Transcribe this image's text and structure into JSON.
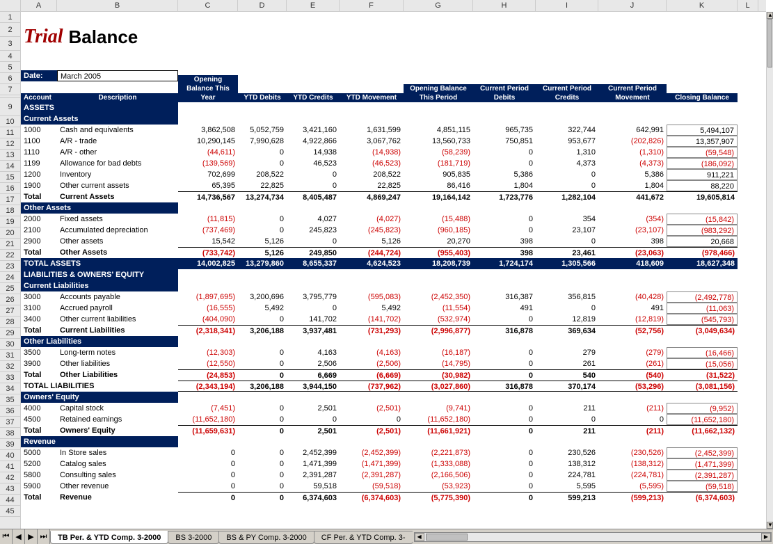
{
  "title": {
    "trial": "Trial",
    "balance": "Balance"
  },
  "date_label": "Date:",
  "date_value": "March 2005",
  "columns": {
    "letters": [
      "A",
      "B",
      "C",
      "D",
      "E",
      "F",
      "G",
      "H",
      "I",
      "J",
      "K",
      "L"
    ],
    "widths": [
      52,
      174,
      86,
      70,
      76,
      92,
      100,
      90,
      90,
      98,
      102,
      30
    ]
  },
  "header": {
    "account": "Account",
    "description": "Description",
    "c": "Opening Balance This Year",
    "d": "YTD Debits",
    "e": "YTD Credits",
    "f": "YTD Movement",
    "g": "Opening Balance This Period",
    "h": "Current Period Debits",
    "i": "Current Period Credits",
    "j": "Current Period Movement",
    "k": "Closing Balance"
  },
  "row_nums": [
    1,
    2,
    3,
    4,
    5,
    6,
    7,
    8,
    9,
    10,
    11,
    12,
    13,
    14,
    15,
    16,
    17,
    18,
    19,
    20,
    21,
    22,
    23,
    24,
    25,
    26,
    27,
    28,
    29,
    30,
    31,
    32,
    33,
    34,
    35,
    36,
    37,
    38,
    39,
    40,
    41,
    42,
    43,
    44,
    45
  ],
  "sections": {
    "assets": "ASSETS",
    "current_assets": "Current Assets",
    "other_assets": "Other Assets",
    "total_assets": "TOTAL ASSETS",
    "liab_eq": "LIABILITIES & OWNERS' EQUITY",
    "current_liab": "Current Liabilities",
    "other_liab": "Other Liabilities",
    "total_liab": "TOTAL LIABILITIES",
    "owners_eq": "Owners' Equity",
    "revenue": "Revenue"
  },
  "rows": [
    {
      "a": "1000",
      "b": "Cash and equivalents",
      "c": "3,862,508",
      "d": "5,052,759",
      "e": "3,421,160",
      "f": "1,631,599",
      "g": "4,851,115",
      "h": "965,735",
      "i": "322,744",
      "j": "642,991",
      "k": "5,494,107"
    },
    {
      "a": "1100",
      "b": "A/R - trade",
      "c": "10,290,145",
      "d": "7,990,628",
      "e": "4,922,866",
      "f": "3,067,762",
      "g": "13,560,733",
      "h": "750,851",
      "i": "953,677",
      "j": "(202,826)",
      "jn": 1,
      "k": "13,357,907"
    },
    {
      "a": "1110",
      "b": "A/R - other",
      "c": "(44,611)",
      "cn": 1,
      "d": "0",
      "e": "14,938",
      "f": "(14,938)",
      "fn": 1,
      "g": "(58,239)",
      "gn": 1,
      "h": "0",
      "i": "1,310",
      "j": "(1,310)",
      "jn": 1,
      "k": "(59,548)",
      "kn": 1
    },
    {
      "a": "1199",
      "b": "Allowance for bad debts",
      "c": "(139,569)",
      "cn": 1,
      "d": "0",
      "e": "46,523",
      "f": "(46,523)",
      "fn": 1,
      "g": "(181,719)",
      "gn": 1,
      "h": "0",
      "i": "4,373",
      "j": "(4,373)",
      "jn": 1,
      "k": "(186,092)",
      "kn": 1
    },
    {
      "a": "1200",
      "b": "Inventory",
      "c": "702,699",
      "d": "208,522",
      "e": "0",
      "f": "208,522",
      "g": "905,835",
      "h": "5,386",
      "i": "0",
      "j": "5,386",
      "k": "911,221"
    },
    {
      "a": "1900",
      "b": "Other current assets",
      "c": "65,395",
      "d": "22,825",
      "e": "0",
      "f": "22,825",
      "g": "86,416",
      "h": "1,804",
      "i": "0",
      "j": "1,804",
      "k": "88,220"
    },
    {
      "a": "Total",
      "b": "Current Assets",
      "c": "14,736,567",
      "d": "13,274,734",
      "e": "8,405,487",
      "f": "4,869,247",
      "g": "19,164,142",
      "h": "1,723,776",
      "i": "1,282,104",
      "j": "441,672",
      "k": "19,605,814",
      "bold": 1,
      "btop": 1
    },
    {
      "sect": "other_assets"
    },
    {
      "a": "2000",
      "b": "Fixed assets",
      "c": "(11,815)",
      "cn": 1,
      "d": "0",
      "e": "4,027",
      "f": "(4,027)",
      "fn": 1,
      "g": "(15,488)",
      "gn": 1,
      "h": "0",
      "i": "354",
      "j": "(354)",
      "jn": 1,
      "k": "(15,842)",
      "kn": 1
    },
    {
      "a": "2100",
      "b": "Accumulated depreciation",
      "c": "(737,469)",
      "cn": 1,
      "d": "0",
      "e": "245,823",
      "f": "(245,823)",
      "fn": 1,
      "g": "(960,185)",
      "gn": 1,
      "h": "0",
      "i": "23,107",
      "j": "(23,107)",
      "jn": 1,
      "k": "(983,292)",
      "kn": 1
    },
    {
      "a": "2900",
      "b": "Other assets",
      "c": "15,542",
      "d": "5,126",
      "e": "0",
      "f": "5,126",
      "g": "20,270",
      "h": "398",
      "i": "0",
      "j": "398",
      "k": "20,668"
    },
    {
      "a": "Total",
      "b": "Other Assets",
      "c": "(733,742)",
      "cn": 1,
      "d": "5,126",
      "e": "249,850",
      "f": "(244,724)",
      "fn": 1,
      "g": "(955,403)",
      "gn": 1,
      "h": "398",
      "i": "23,461",
      "j": "(23,063)",
      "jn": 1,
      "k": "(978,466)",
      "kn": 1,
      "bold": 1,
      "btop": 1
    },
    {
      "total": 1,
      "a": "TOTAL ASSETS",
      "b": "",
      "c": "14,002,825",
      "d": "13,279,860",
      "e": "8,655,337",
      "f": "4,624,523",
      "g": "18,208,739",
      "h": "1,724,174",
      "i": "1,305,566",
      "j": "418,609",
      "k": "18,627,348"
    },
    {
      "sect": "liab_eq",
      "full": 1
    },
    {
      "sect": "current_liab"
    },
    {
      "a": "3000",
      "b": "Accounts payable",
      "c": "(1,897,695)",
      "cn": 1,
      "d": "3,200,696",
      "e": "3,795,779",
      "f": "(595,083)",
      "fn": 1,
      "g": "(2,452,350)",
      "gn": 1,
      "h": "316,387",
      "i": "356,815",
      "j": "(40,428)",
      "jn": 1,
      "k": "(2,492,778)",
      "kn": 1
    },
    {
      "a": "3100",
      "b": "Accrued payroll",
      "c": "(16,555)",
      "cn": 1,
      "d": "5,492",
      "e": "0",
      "f": "5,492",
      "g": "(11,554)",
      "gn": 1,
      "h": "491",
      "i": "0",
      "j": "491",
      "k": "(11,063)",
      "kn": 1
    },
    {
      "a": "3400",
      "b": "Other current liabilities",
      "c": "(404,090)",
      "cn": 1,
      "d": "0",
      "e": "141,702",
      "f": "(141,702)",
      "fn": 1,
      "g": "(532,974)",
      "gn": 1,
      "h": "0",
      "i": "12,819",
      "j": "(12,819)",
      "jn": 1,
      "k": "(545,793)",
      "kn": 1
    },
    {
      "a": "Total",
      "b": "Current Liabilities",
      "c": "(2,318,341)",
      "cn": 1,
      "d": "3,206,188",
      "e": "3,937,481",
      "f": "(731,293)",
      "fn": 1,
      "g": "(2,996,877)",
      "gn": 1,
      "h": "316,878",
      "i": "369,634",
      "j": "(52,756)",
      "jn": 1,
      "k": "(3,049,634)",
      "kn": 1,
      "bold": 1,
      "btop": 1
    },
    {
      "sect": "other_liab"
    },
    {
      "a": "3500",
      "b": "Long-term notes",
      "c": "(12,303)",
      "cn": 1,
      "d": "0",
      "e": "4,163",
      "f": "(4,163)",
      "fn": 1,
      "g": "(16,187)",
      "gn": 1,
      "h": "0",
      "i": "279",
      "j": "(279)",
      "jn": 1,
      "k": "(16,466)",
      "kn": 1
    },
    {
      "a": "3900",
      "b": "Other liabilities",
      "c": "(12,550)",
      "cn": 1,
      "d": "0",
      "e": "2,506",
      "f": "(2,506)",
      "fn": 1,
      "g": "(14,795)",
      "gn": 1,
      "h": "0",
      "i": "261",
      "j": "(261)",
      "jn": 1,
      "k": "(15,056)",
      "kn": 1
    },
    {
      "a": "Total",
      "b": "Other Liabilities",
      "c": "(24,853)",
      "cn": 1,
      "d": "0",
      "e": "6,669",
      "f": "(6,669)",
      "fn": 1,
      "g": "(30,982)",
      "gn": 1,
      "h": "0",
      "i": "540",
      "j": "(540)",
      "jn": 1,
      "k": "(31,522)",
      "kn": 1,
      "bold": 1,
      "btop": 1
    },
    {
      "a": "TOTAL LIABILITIES",
      "b": "",
      "c": "(2,343,194)",
      "cn": 1,
      "d": "3,206,188",
      "e": "3,944,150",
      "f": "(737,962)",
      "fn": 1,
      "g": "(3,027,860)",
      "gn": 1,
      "h": "316,878",
      "i": "370,174",
      "j": "(53,296)",
      "jn": 1,
      "k": "(3,081,156)",
      "kn": 1,
      "bold": 1,
      "bthick": 1,
      "span": 1
    },
    {
      "sect": "owners_eq"
    },
    {
      "a": "4000",
      "b": "Capital stock",
      "c": "(7,451)",
      "cn": 1,
      "d": "0",
      "e": "2,501",
      "f": "(2,501)",
      "fn": 1,
      "g": "(9,741)",
      "gn": 1,
      "h": "0",
      "i": "211",
      "j": "(211)",
      "jn": 1,
      "k": "(9,952)",
      "kn": 1
    },
    {
      "a": "4500",
      "b": "Retained earnings",
      "c": "(11,652,180)",
      "cn": 1,
      "d": "0",
      "e": "0",
      "f": "0",
      "g": "(11,652,180)",
      "gn": 1,
      "h": "0",
      "i": "0",
      "j": "0",
      "k": "(11,652,180)",
      "kn": 1
    },
    {
      "a": "Total",
      "b": "Owners' Equity",
      "c": "(11,659,631)",
      "cn": 1,
      "d": "0",
      "e": "2,501",
      "f": "(2,501)",
      "fn": 1,
      "g": "(11,661,921)",
      "gn": 1,
      "h": "0",
      "i": "211",
      "j": "(211)",
      "jn": 1,
      "k": "(11,662,132)",
      "kn": 1,
      "bold": 1,
      "btop": 1
    },
    {
      "sect": "revenue"
    },
    {
      "a": "5000",
      "b": "In Store sales",
      "c": "0",
      "d": "0",
      "e": "2,452,399",
      "f": "(2,452,399)",
      "fn": 1,
      "g": "(2,221,873)",
      "gn": 1,
      "h": "0",
      "i": "230,526",
      "j": "(230,526)",
      "jn": 1,
      "k": "(2,452,399)",
      "kn": 1
    },
    {
      "a": "5200",
      "b": "Catalog sales",
      "c": "0",
      "d": "0",
      "e": "1,471,399",
      "f": "(1,471,399)",
      "fn": 1,
      "g": "(1,333,088)",
      "gn": 1,
      "h": "0",
      "i": "138,312",
      "j": "(138,312)",
      "jn": 1,
      "k": "(1,471,399)",
      "kn": 1
    },
    {
      "a": "5800",
      "b": "Consulting sales",
      "c": "0",
      "d": "0",
      "e": "2,391,287",
      "f": "(2,391,287)",
      "fn": 1,
      "g": "(2,166,506)",
      "gn": 1,
      "h": "0",
      "i": "224,781",
      "j": "(224,781)",
      "jn": 1,
      "k": "(2,391,287)",
      "kn": 1
    },
    {
      "a": "5900",
      "b": "Other revenue",
      "c": "0",
      "d": "0",
      "e": "59,518",
      "f": "(59,518)",
      "fn": 1,
      "g": "(53,923)",
      "gn": 1,
      "h": "0",
      "i": "5,595",
      "j": "(5,595)",
      "jn": 1,
      "k": "(59,518)",
      "kn": 1
    },
    {
      "a": "Total",
      "b": "Revenue",
      "c": "0",
      "d": "0",
      "e": "6,374,603",
      "f": "(6,374,603)",
      "fn": 1,
      "g": "(5,775,390)",
      "gn": 1,
      "h": "0",
      "i": "599,213",
      "j": "(599,213)",
      "jn": 1,
      "k": "(6,374,603)",
      "kn": 1,
      "bold": 1,
      "btop": 1
    }
  ],
  "tabs": [
    {
      "label": "TB Per. & YTD Comp.  3-2000",
      "active": true
    },
    {
      "label": "BS  3-2000"
    },
    {
      "label": "BS & PY Comp.  3-2000"
    },
    {
      "label": "CF Per. & YTD Comp. 3-"
    }
  ]
}
